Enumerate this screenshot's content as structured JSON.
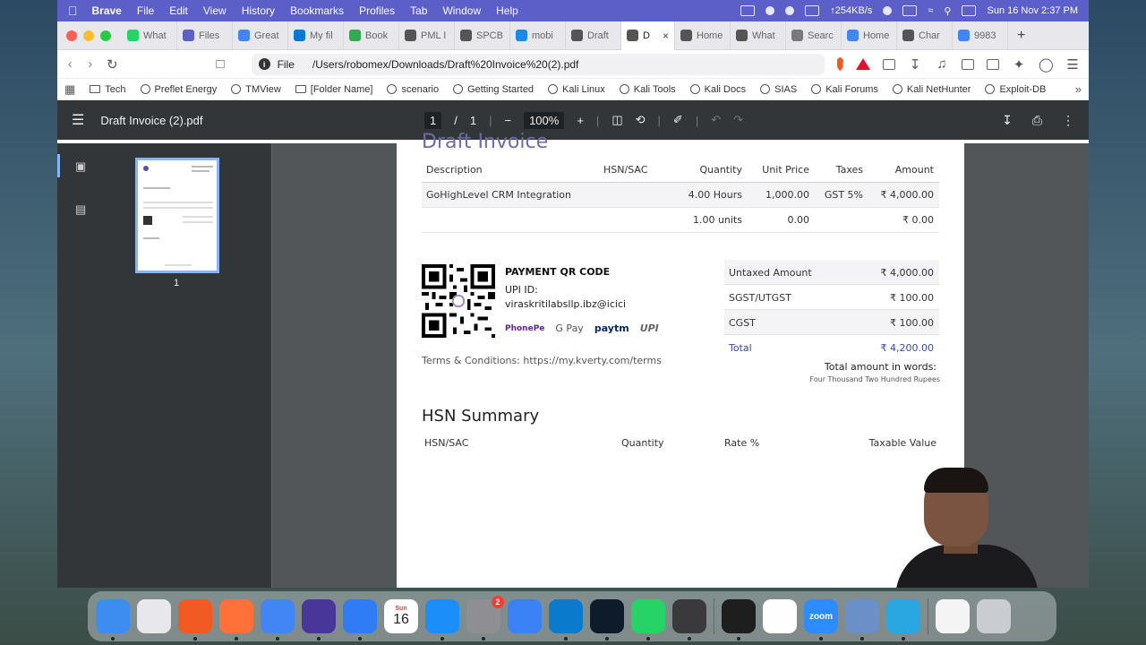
{
  "menubar": {
    "items": [
      "Brave",
      "File",
      "Edit",
      "View",
      "History",
      "Bookmarks",
      "Profiles",
      "Tab",
      "Window",
      "Help"
    ],
    "network": "↑254KB/s",
    "datetime": "Sun 16 Nov  2:37 PM"
  },
  "tabs": [
    {
      "label": "What",
      "color": "#25d366"
    },
    {
      "label": "Files",
      "color": "#5b5fc7"
    },
    {
      "label": "Great",
      "color": "#4285f4"
    },
    {
      "label": "My fil",
      "color": "#0078d4"
    },
    {
      "label": "Book",
      "color": "#34a853"
    },
    {
      "label": "PML I",
      "color": "#555555"
    },
    {
      "label": "SPCB",
      "color": "#555555"
    },
    {
      "label": "mobi",
      "color": "#1e88e5"
    },
    {
      "label": "Draft",
      "color": "#555555"
    },
    {
      "label": "D",
      "color": "#555555"
    },
    {
      "label": "Home",
      "color": "#555555"
    },
    {
      "label": "What",
      "color": "#555555"
    },
    {
      "label": "Searc",
      "color": "#7a7a7a"
    },
    {
      "label": "Home",
      "color": "#4285f4"
    },
    {
      "label": "Char",
      "color": "#555555"
    },
    {
      "label": "9983",
      "color": "#4285f4"
    }
  ],
  "address": {
    "scheme": "File",
    "path": "/Users/robomex/Downloads/Draft%20Invoice%20(2).pdf"
  },
  "bookmarks": [
    {
      "label": "Tech",
      "kind": "folder"
    },
    {
      "label": "Preflet Energy",
      "kind": "site"
    },
    {
      "label": "TMView",
      "kind": "site"
    },
    {
      "label": "[Folder Name]",
      "kind": "folder"
    },
    {
      "label": "scenario",
      "kind": "site"
    },
    {
      "label": "Getting Started",
      "kind": "site"
    },
    {
      "label": "Kali Linux",
      "kind": "site"
    },
    {
      "label": "Kali Tools",
      "kind": "site"
    },
    {
      "label": "Kali Docs",
      "kind": "site"
    },
    {
      "label": "SIAS",
      "kind": "site"
    },
    {
      "label": "Kali Forums",
      "kind": "site"
    },
    {
      "label": "Kali NetHunter",
      "kind": "site"
    },
    {
      "label": "Exploit-DB",
      "kind": "site"
    }
  ],
  "pdf": {
    "filename": "Draft Invoice (2).pdf",
    "page_current": "1",
    "page_sep": "/",
    "page_total": "1",
    "zoom": "100%",
    "thumb_label": "1"
  },
  "invoice": {
    "title_partial": "Draft Invoice",
    "columns": [
      "Description",
      "HSN/SAC",
      "Quantity",
      "Unit Price",
      "Taxes",
      "Amount"
    ],
    "lines": [
      {
        "description": "GoHighLevel CRM Integration",
        "hsn": "",
        "quantity": "4.00 Hours",
        "unit_price": "1,000.00",
        "taxes": "GST 5%",
        "amount": "₹ 4,000.00"
      },
      {
        "description": "",
        "hsn": "",
        "quantity": "1.00 units",
        "unit_price": "0.00",
        "taxes": "",
        "amount": "₹ 0.00"
      }
    ],
    "payment": {
      "title": "PAYMENT QR CODE",
      "upi_label": "UPI ID:",
      "upi_id": "viraskritilabsllp.ibz@icici",
      "logos": [
        "PhonePe",
        "G Pay",
        "paytm",
        "UPI"
      ]
    },
    "terms": "Terms & Conditions: https://my.kverty.com/terms",
    "totals": [
      {
        "label": "Untaxed Amount",
        "value": "₹ 4,000.00"
      },
      {
        "label": "SGST/UTGST",
        "value": "₹ 100.00"
      },
      {
        "label": "CGST",
        "value": "₹ 100.00"
      },
      {
        "label": "Total",
        "value": "₹ 4,200.00"
      }
    ],
    "words_label": "Total amount in words:",
    "words": "Four Thousand Two Hundred Rupees",
    "hsn_summary": {
      "title": "HSN Summary",
      "columns": [
        "HSN/SAC",
        "Quantity",
        "Rate %",
        "Taxable Value"
      ]
    }
  },
  "dock": [
    {
      "name": "finder",
      "color": "#3d8cf0"
    },
    {
      "name": "launchpad",
      "color": "#e8e8ec"
    },
    {
      "name": "brave",
      "color": "#f25a24"
    },
    {
      "name": "firefox",
      "color": "#ff7139"
    },
    {
      "name": "chrome",
      "color": "#4285f4"
    },
    {
      "name": "obsidian",
      "color": "#483699"
    },
    {
      "name": "tasks",
      "color": "#2f7cf6"
    },
    {
      "name": "calendar",
      "color": "#ffffff"
    },
    {
      "name": "app-store",
      "color": "#1c8ef9"
    },
    {
      "name": "system-settings",
      "color": "#8e8e93"
    },
    {
      "name": "simulator",
      "color": "#3b82f6"
    },
    {
      "name": "vscode",
      "color": "#0a7acc"
    },
    {
      "name": "rawdigger",
      "color": "#0d1b2a"
    },
    {
      "name": "whatsapp",
      "color": "#25d366"
    },
    {
      "name": "obs",
      "color": "#3a3a3c"
    },
    {
      "name": "terminal",
      "color": "#1e1e1e"
    },
    {
      "name": "notes",
      "color": "#fefefe"
    },
    {
      "name": "zoom",
      "color": "#2d8cff"
    },
    {
      "name": "disk-utility",
      "color": "#6b8fc7"
    },
    {
      "name": "sync",
      "color": "#2aa7e0"
    },
    {
      "name": "downloads-stack",
      "color": "#f4f4f4"
    },
    {
      "name": "trash",
      "color": "#c9ccd1"
    }
  ],
  "dock_labels": {
    "calendar_month": "Sun",
    "calendar_day": "16",
    "zoom": "zoom",
    "settings_badge": "2"
  }
}
